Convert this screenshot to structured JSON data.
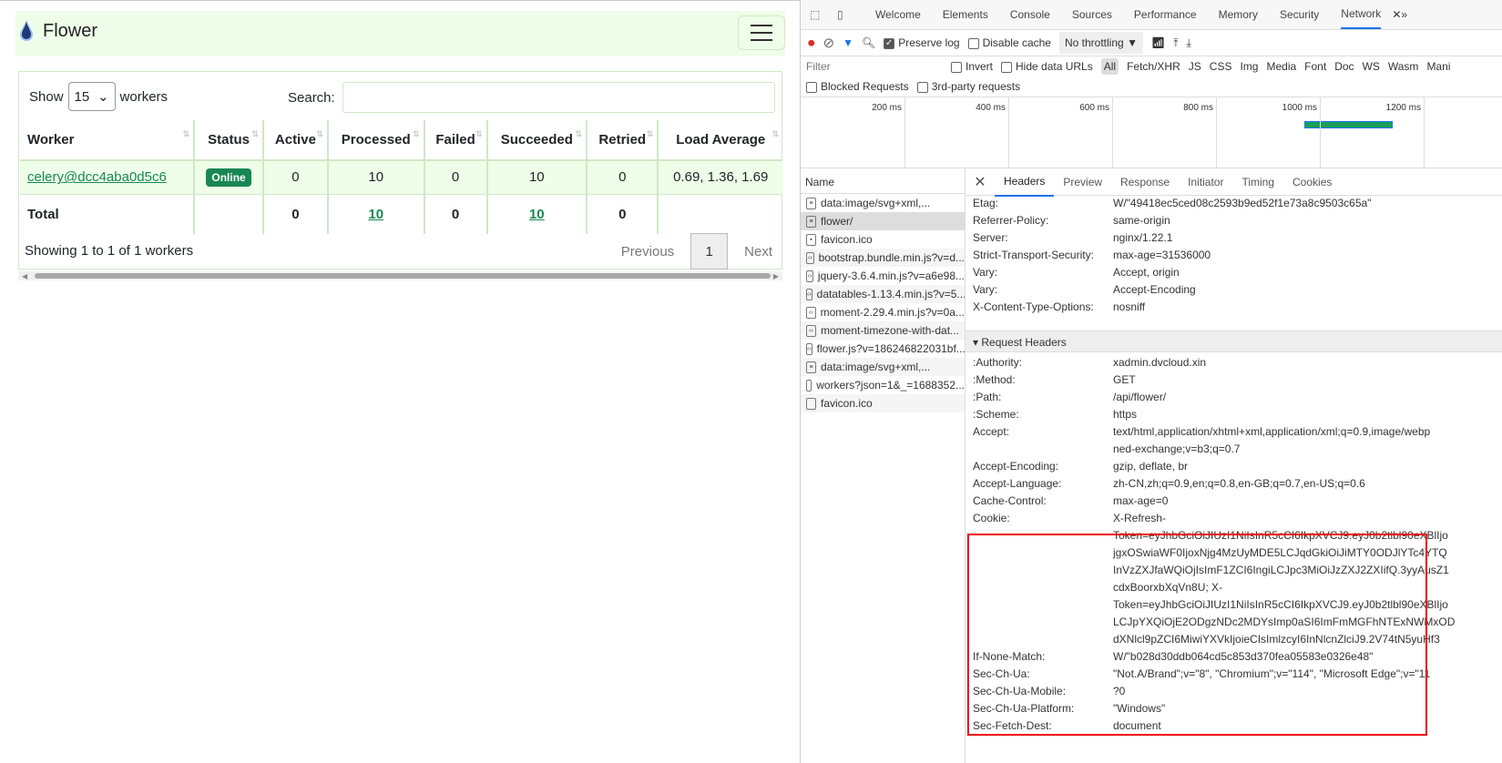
{
  "flower": {
    "brand": "Flower",
    "show_label": "Show",
    "page_size": "15",
    "workers_label": "workers",
    "search_label": "Search:",
    "search_value": "",
    "columns": [
      "Worker",
      "Status",
      "Active",
      "Processed",
      "Failed",
      "Succeeded",
      "Retried",
      "Load Average"
    ],
    "rows": [
      {
        "worker": "celery@dcc4aba0d5c6",
        "status": "Online",
        "active": "0",
        "processed": "10",
        "failed": "0",
        "succeeded": "10",
        "retried": "0",
        "load": "0.69, 1.36, 1.69"
      }
    ],
    "total": {
      "label": "Total",
      "active": "0",
      "processed": "10",
      "failed": "0",
      "succeeded": "10",
      "retried": "0"
    },
    "info": "Showing 1 to 1 of 1 workers",
    "prev": "Previous",
    "page": "1",
    "next": "Next",
    "accent": "#198754"
  },
  "devtools": {
    "tabs": [
      "Welcome",
      "Elements",
      "Console",
      "Sources",
      "Performance",
      "Memory",
      "Security",
      "Network"
    ],
    "preserve_log": "Preserve log",
    "disable_cache": "Disable cache",
    "throttling": "No throttling",
    "filter_placeholder": "Filter",
    "invert": "Invert",
    "hide_data_urls": "Hide data URLs",
    "types": [
      "All",
      "Fetch/XHR",
      "JS",
      "CSS",
      "Img",
      "Media",
      "Font",
      "Doc",
      "WS",
      "Wasm",
      "Mani"
    ],
    "blocked": "Blocked Requests",
    "third_party": "3rd-party requests",
    "ticks": [
      "200 ms",
      "400 ms",
      "600 ms",
      "800 ms",
      "1000 ms",
      "1200 ms"
    ],
    "name_header": "Name",
    "requests": [
      {
        "name": "data:image/svg+xml,...",
        "icon": "doc"
      },
      {
        "name": "flower/",
        "icon": "doc"
      },
      {
        "name": "favicon.ico",
        "icon": "img"
      },
      {
        "name": "bootstrap.bundle.min.js?v=d...",
        "icon": "script"
      },
      {
        "name": "jquery-3.6.4.min.js?v=a6e98...",
        "icon": "script"
      },
      {
        "name": "datatables-1.13.4.min.js?v=5...",
        "icon": "script"
      },
      {
        "name": "moment-2.29.4.min.js?v=0a...",
        "icon": "script"
      },
      {
        "name": "moment-timezone-with-dat...",
        "icon": "script"
      },
      {
        "name": "flower.js?v=186246822031bf...",
        "icon": "script"
      },
      {
        "name": "data:image/svg+xml,...",
        "icon": "doc"
      },
      {
        "name": "workers?json=1&_=1688352...",
        "icon": "xhr"
      },
      {
        "name": "favicon.ico",
        "icon": "xhr"
      }
    ],
    "detail_tabs": [
      "Headers",
      "Preview",
      "Response",
      "Initiator",
      "Timing",
      "Cookies"
    ],
    "response_headers": [
      {
        "k": "Etag:",
        "v": [
          "W/\"49418ec5ced08c2593b9ed52f1e73a8c9503c65a\""
        ]
      },
      {
        "k": "Referrer-Policy:",
        "v": [
          "same-origin"
        ]
      },
      {
        "k": "Server:",
        "v": [
          "nginx/1.22.1"
        ]
      },
      {
        "k": "Strict-Transport-Security:",
        "v": [
          "max-age=31536000"
        ]
      },
      {
        "k": "Vary:",
        "v": [
          "Accept, origin"
        ]
      },
      {
        "k": "Vary:",
        "v": [
          "Accept-Encoding"
        ]
      },
      {
        "k": "X-Content-Type-Options:",
        "v": [
          "nosniff"
        ]
      }
    ],
    "request_section": "Request Headers",
    "request_headers": [
      {
        "k": ":Authority:",
        "v": [
          "xadmin.dvcloud.xin"
        ]
      },
      {
        "k": ":Method:",
        "v": [
          "GET"
        ]
      },
      {
        "k": ":Path:",
        "v": [
          "/api/flower/"
        ]
      },
      {
        "k": ":Scheme:",
        "v": [
          "https"
        ]
      },
      {
        "k": "Accept:",
        "v": [
          "text/html,application/xhtml+xml,application/xml;q=0.9,image/webp",
          "ned-exchange;v=b3;q=0.7"
        ]
      },
      {
        "k": "Accept-Encoding:",
        "v": [
          "gzip, deflate, br"
        ]
      },
      {
        "k": "Accept-Language:",
        "v": [
          "zh-CN,zh;q=0.9,en;q=0.8,en-GB;q=0.7,en-US;q=0.6"
        ]
      },
      {
        "k": "Cache-Control:",
        "v": [
          "max-age=0"
        ]
      },
      {
        "k": "Cookie:",
        "v": [
          "X-Refresh-",
          "Token=eyJhbGciOiJIUzI1NiIsInR5cCI6IkpXVCJ9.eyJ0b2tlbl90eXBlIjo",
          "jgxOSwiaWF0IjoxNjg4MzUyMDE5LCJqdGkiOiJiMTY0ODJlYTc4YTQ",
          "InVzZXJfaWQiOjIsImF1ZCI6IngiLCJpc3MiOiJzZXJ2ZXIifQ.3yyAusZ1",
          "cdxBoorxbXqVn8U; X-",
          "Token=eyJhbGciOiJIUzI1NiIsInR5cCI6IkpXVCJ9.eyJ0b2tlbl90eXBlIjo",
          "LCJpYXQiOjE2ODgzNDc2MDYsImp0aSI6ImFmMGFhNTExNWMxOD",
          "dXNlcl9pZCI6MiwiYXVkIjoieCIsImlzcyI6InNlcnZlciJ9.2V74tN5yuHf3"
        ]
      },
      {
        "k": "If-None-Match:",
        "v": [
          "W/\"b028d30ddb064cd5c853d370fea05583e0326e48\""
        ]
      },
      {
        "k": "Sec-Ch-Ua:",
        "v": [
          "\"Not.A/Brand\";v=\"8\", \"Chromium\";v=\"114\", \"Microsoft Edge\";v=\"11"
        ]
      },
      {
        "k": "Sec-Ch-Ua-Mobile:",
        "v": [
          "?0"
        ]
      },
      {
        "k": "Sec-Ch-Ua-Platform:",
        "v": [
          "\"Windows\""
        ]
      },
      {
        "k": "Sec-Fetch-Dest:",
        "v": [
          "document"
        ]
      }
    ],
    "highlight_color": "#e00000"
  }
}
